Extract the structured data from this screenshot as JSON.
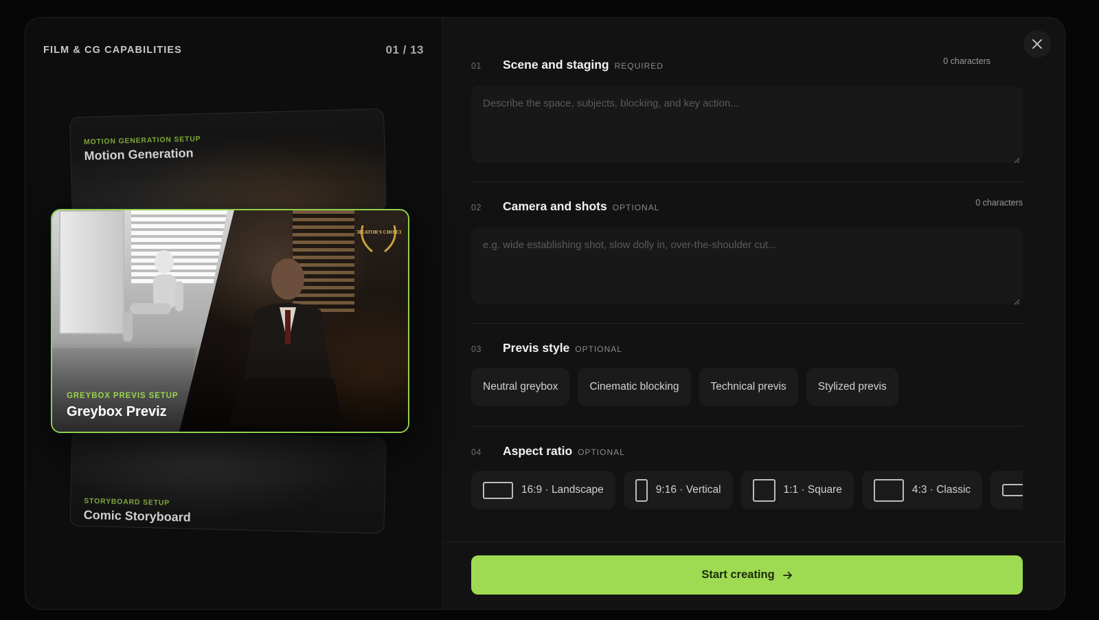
{
  "left_panel": {
    "title": "FILM & CG CAPABILITIES",
    "counter": "01 / 13",
    "cards": {
      "top": {
        "sub": "MOTION GENERATION SETUP",
        "name": "Motion Generation"
      },
      "front": {
        "sub": "GREYBOX PREVIS SETUP",
        "name": "Greybox Previz",
        "badge": "CREATOR'S CHOICE"
      },
      "bottom": {
        "sub": "STORYBOARD SETUP",
        "name": "Comic Storyboard"
      }
    }
  },
  "form": {
    "scene": {
      "num": "01",
      "title": "Scene and staging",
      "tag": "REQUIRED",
      "count": "0 characters",
      "placeholder": "Describe the space, subjects, blocking, and key action..."
    },
    "camera": {
      "num": "02",
      "title": "Camera and shots",
      "tag": "OPTIONAL",
      "count": "0 characters",
      "placeholder": "e.g. wide establishing shot, slow dolly in, over-the-shoulder cut..."
    },
    "style": {
      "num": "03",
      "title": "Previs style",
      "tag": "OPTIONAL",
      "options": [
        "Neutral greybox",
        "Cinematic blocking",
        "Technical previs",
        "Stylized previs"
      ]
    },
    "aspect": {
      "num": "04",
      "title": "Aspect ratio",
      "tag": "OPTIONAL",
      "options": [
        "16:9 · Landscape",
        "9:16 · Vertical",
        "1:1 · Square",
        "4:3 · Classic",
        ""
      ]
    }
  },
  "footer": {
    "start_label": "Start creating"
  },
  "colors": {
    "accent": "#9fdb52",
    "accent_text": "#9bd54e"
  }
}
